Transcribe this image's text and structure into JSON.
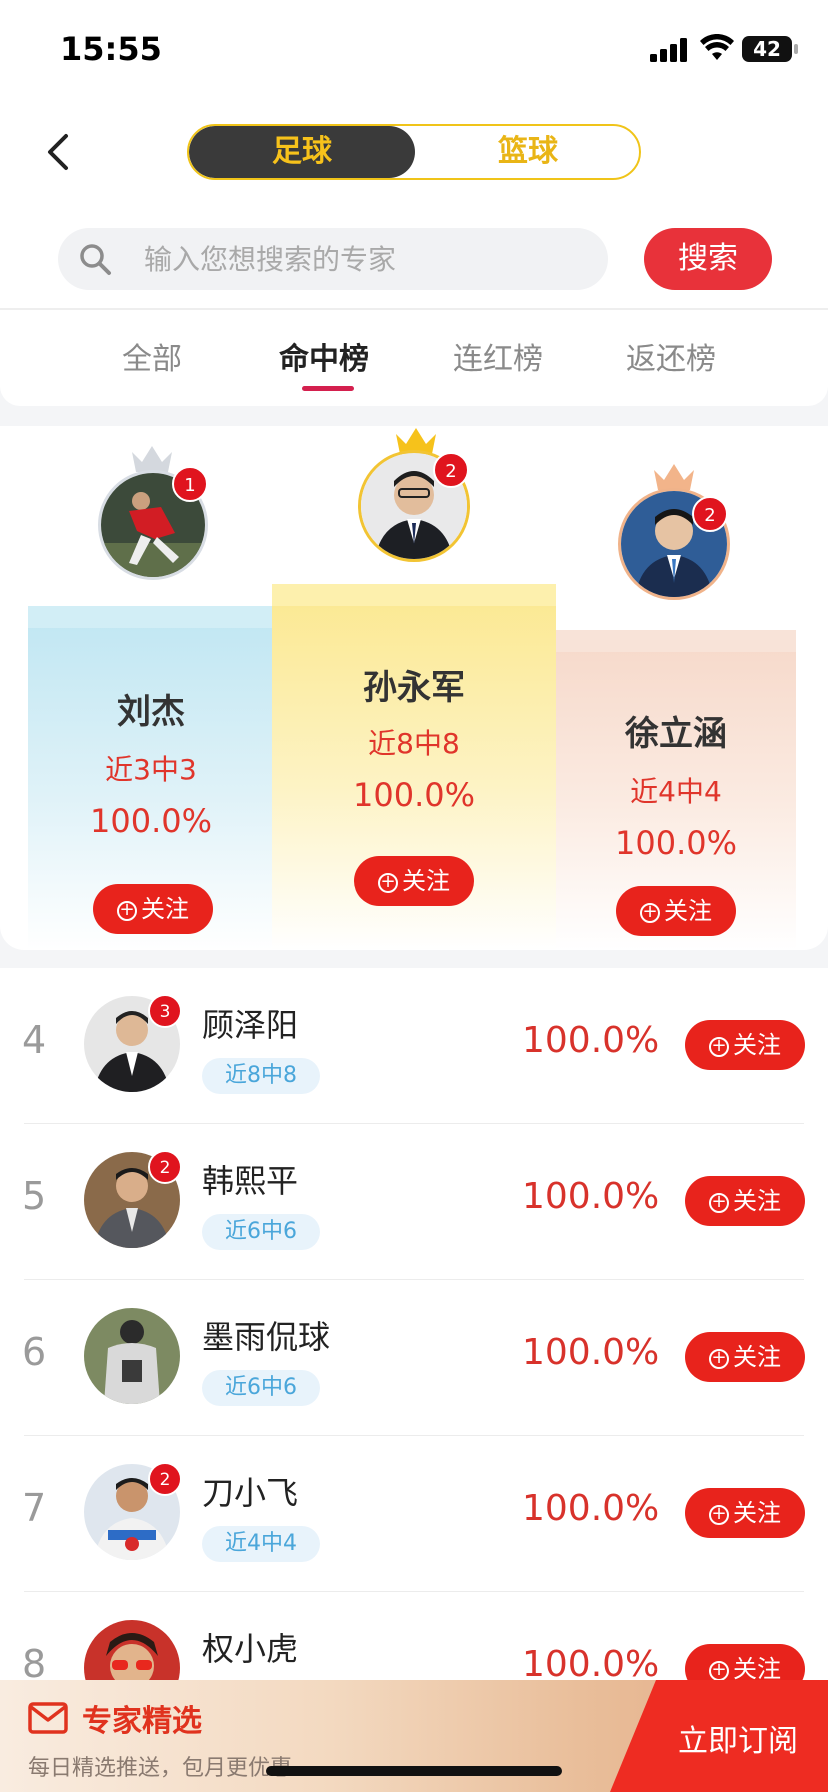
{
  "status": {
    "time": "15:55",
    "battery": "42"
  },
  "header": {
    "sport_tabs": [
      "足球",
      "篮球"
    ],
    "search_placeholder": "输入您想搜索的专家",
    "search_button": "搜索"
  },
  "tabs": [
    "全部",
    "命中榜",
    "连红榜",
    "返还榜"
  ],
  "active_tab": "命中榜",
  "follow_label": "关注",
  "podium": [
    {
      "name": "刘杰",
      "record": "近3中3",
      "rate": "100.0%",
      "badge": "1",
      "crown": "silver"
    },
    {
      "name": "孙永军",
      "record": "近8中8",
      "rate": "100.0%",
      "badge": "2",
      "crown": "gold"
    },
    {
      "name": "徐立涵",
      "record": "近4中4",
      "rate": "100.0%",
      "badge": "2",
      "crown": "bronze"
    }
  ],
  "list": [
    {
      "rank": "4",
      "name": "顾泽阳",
      "record": "近8中8",
      "rate": "100.0%",
      "badge": "3"
    },
    {
      "rank": "5",
      "name": "韩熙平",
      "record": "近6中6",
      "rate": "100.0%",
      "badge": "2"
    },
    {
      "rank": "6",
      "name": "墨雨侃球",
      "record": "近6中6",
      "rate": "100.0%",
      "badge": ""
    },
    {
      "rank": "7",
      "name": "刀小飞",
      "record": "近4中4",
      "rate": "100.0%",
      "badge": "2"
    },
    {
      "rank": "8",
      "name": "权小虎",
      "record": "",
      "rate": "100.0%",
      "badge": ""
    }
  ],
  "banner": {
    "title": "专家精选",
    "subtitle": "每日精选推送，包月更优惠",
    "cta": "立即订阅"
  },
  "colors": {
    "accent_red": "#e8231c",
    "gold": "#f7c21b",
    "record_blue": "#4aa6da"
  }
}
